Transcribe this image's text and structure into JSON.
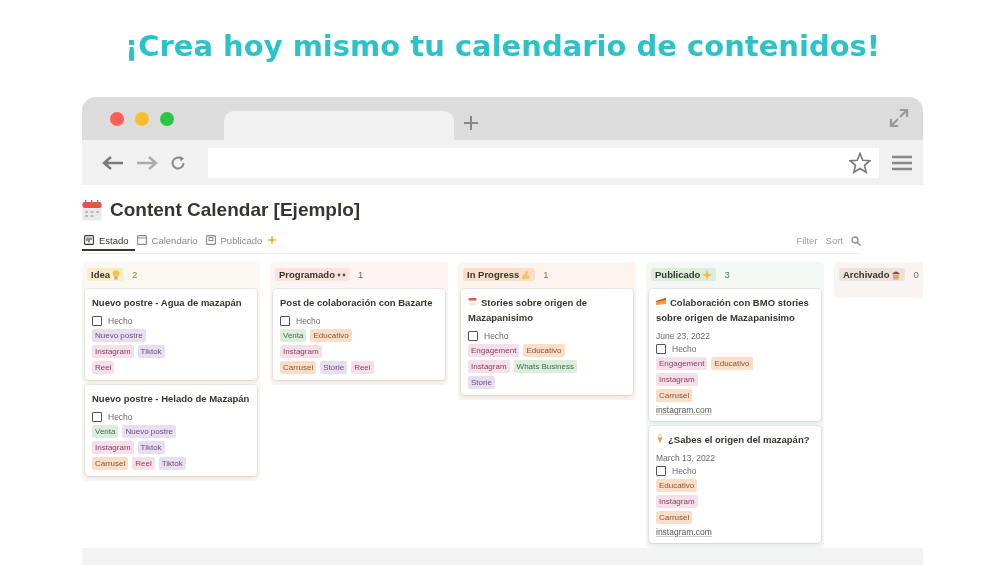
{
  "headline": "¡Crea hoy mismo tu calendario de contenidos!",
  "page": {
    "title": "Content Calendar [Ejemplo]"
  },
  "views": [
    {
      "label": "Estado",
      "selected": true
    },
    {
      "label": "Calendario",
      "selected": false
    },
    {
      "label": "Publicado",
      "selected": false
    }
  ],
  "toolbar": [
    "Filter",
    "Sort"
  ],
  "columns": [
    {
      "label": "Idea",
      "color": "#fdecc8",
      "count": "2",
      "cards": [
        {
          "title": "Nuevo postre - Agua de mazapán",
          "checkbox_label": "Hecho",
          "checked": false,
          "tag_rows": [
            [
              {
                "label": "Nuevo postre",
                "color": "#e8deee"
              }
            ],
            [
              {
                "label": "Instagram",
                "color": "#f5e0e9"
              },
              {
                "label": "Tiktok",
                "color": "#e8deee"
              }
            ],
            [
              {
                "label": "Reel",
                "color": "#f5e0e9"
              }
            ]
          ]
        },
        {
          "title": "Nuevo postre - Helado de Mazapán",
          "checkbox_label": "Hecho",
          "checked": false,
          "tag_rows": [
            [
              {
                "label": "Venta",
                "color": "#dbeddb"
              },
              {
                "label": "Nuevo postre",
                "color": "#e8deee"
              }
            ],
            [
              {
                "label": "Instagram",
                "color": "#f5e0e9"
              },
              {
                "label": "Tiktok",
                "color": "#e8deee"
              }
            ],
            [
              {
                "label": "Carrusel",
                "color": "#fadec9"
              },
              {
                "label": "Reel",
                "color": "#f5e0e9"
              },
              {
                "label": "Tiktok",
                "color": "#e8deee"
              }
            ]
          ]
        }
      ]
    },
    {
      "label": "Programado",
      "color": "#ffe2dd",
      "count": "1",
      "cards": [
        {
          "title": "Post de colaboración con Bazarte",
          "checkbox_label": "Hecho",
          "checked": false,
          "tag_rows": [
            [
              {
                "label": "Venta",
                "color": "#dbeddb"
              },
              {
                "label": "Educativo",
                "color": "#fadec9"
              }
            ],
            [
              {
                "label": "Instagram",
                "color": "#f5e0e9"
              }
            ],
            [
              {
                "label": "Carrusel",
                "color": "#fadec9"
              },
              {
                "label": "Storie",
                "color": "#e8deee"
              },
              {
                "label": "Reel",
                "color": "#f5e0e9"
              }
            ]
          ]
        }
      ]
    },
    {
      "label": "In Progress",
      "color": "#fadec9",
      "count": "1",
      "cards": [
        {
          "has_icon": true,
          "title": "Stories sobre origen de Mazapanisimo",
          "checkbox_label": "Hecho",
          "checked": false,
          "tag_rows": [
            [
              {
                "label": "Engagement",
                "color": "#f5e0e9"
              },
              {
                "label": "Educativo",
                "color": "#fadec9"
              }
            ],
            [
              {
                "label": "Instagram",
                "color": "#f5e0e9"
              },
              {
                "label": "Whats Business",
                "color": "#dbeddb"
              }
            ],
            [
              {
                "label": "Storie",
                "color": "#e8deee"
              }
            ]
          ]
        }
      ]
    },
    {
      "label": "Publicado",
      "color": "#dbeddb",
      "count": "3",
      "cards": [
        {
          "has_icon": true,
          "title": "Colaboración con BMO stories sobre origen de Mazapanisimo",
          "date": "June 23, 2022",
          "checkbox_label": "Hecho",
          "checked": false,
          "tag_rows": [
            [
              {
                "label": "Engagement",
                "color": "#f5e0e9"
              },
              {
                "label": "Educativo",
                "color": "#fadec9"
              }
            ],
            [
              {
                "label": "Instagram",
                "color": "#f5e0e9"
              }
            ],
            [
              {
                "label": "Carrusel",
                "color": "#fadec9"
              }
            ]
          ],
          "link": "instagram.com"
        },
        {
          "has_icon": true,
          "title": "¿Sabes el origen del mazapán?",
          "date": "March 13, 2022",
          "checkbox_label": "Hecho",
          "checked": false,
          "tag_rows": [
            [
              {
                "label": "Educativo",
                "color": "#fadec9"
              }
            ],
            [
              {
                "label": "Instagram",
                "color": "#f5e0e9"
              }
            ],
            [
              {
                "label": "Carrusel",
                "color": "#fadec9"
              }
            ]
          ],
          "link": "instagram.com"
        }
      ]
    },
    {
      "label": "Archivado",
      "color": "#eee0da",
      "count": "0"
    }
  ]
}
